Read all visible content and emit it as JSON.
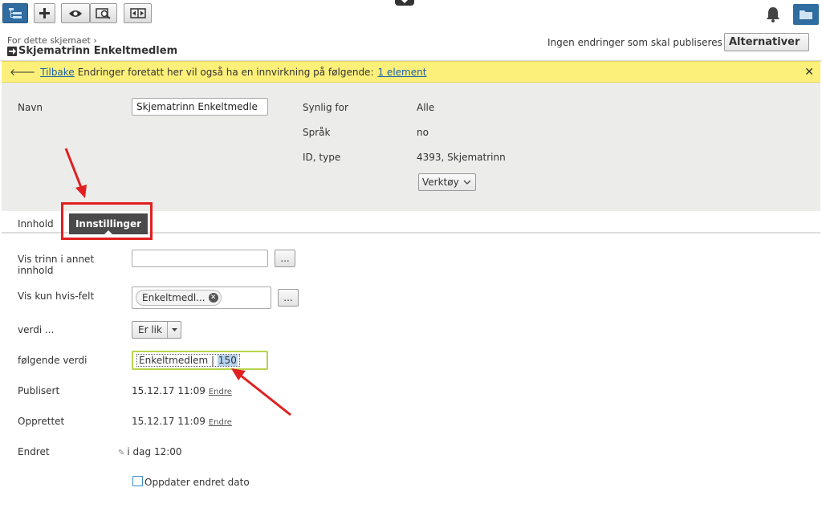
{
  "header": {
    "breadcrumb": "For dette skjemaet",
    "title": "Skjematrinn Enkeltmedlem",
    "publish_status": "Ingen endringer som skal publiseres",
    "alternatives_label": "Alternativer"
  },
  "notice": {
    "back_link": "Tilbake",
    "message": "Endringer foretatt her vil også ha en innvirkning på følgende:",
    "link": "1 element"
  },
  "properties": {
    "name_label": "Navn",
    "name_value": "Skjematrinn Enkeltmedle",
    "visible_for_label": "Synlig for",
    "visible_for_value": "Alle",
    "language_label": "Språk",
    "language_value": "no",
    "id_type_label": "ID, type",
    "id_type_value": "4393, Skjematrinn",
    "tools_label": "Verktøy"
  },
  "tabs": {
    "content": "Innhold",
    "settings": "Innstillinger"
  },
  "settings": {
    "show_step_label_1": "Vis trinn i annet",
    "show_step_label_2": "innhold",
    "show_if_label": "Vis kun hvis-felt",
    "show_if_chip": "Enkeltmedl...",
    "dots": "...",
    "value_label": "verdi ...",
    "value_select": "Er lik",
    "following_value_label": "følgende verdi",
    "following_value_prefix": "Enkeltmedlem |",
    "following_value_selected": "150",
    "published_label": "Publisert",
    "published_value": "15.12.17 11:09",
    "created_label": "Opprettet",
    "created_value": "15.12.17 11:09",
    "change_link": "Endre",
    "changed_label": "Endret",
    "changed_value": "i dag 12:00",
    "update_date_label": "Oppdater endret dato"
  },
  "colors": {
    "notice_bg": "#fdf07a",
    "accent_blue": "#2f6c9f",
    "annotation_red": "#e02020",
    "focus_green": "#b8d44a"
  }
}
